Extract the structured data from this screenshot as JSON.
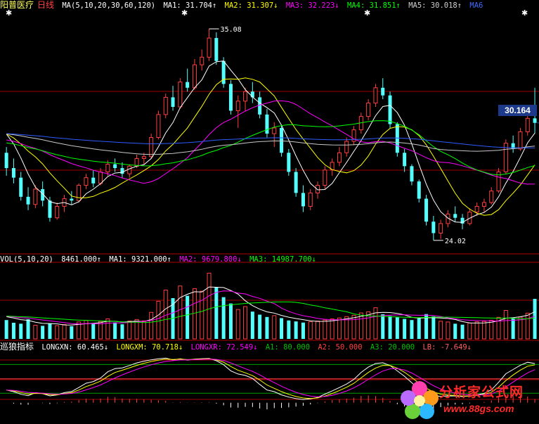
{
  "colors": {
    "up": "#ff4040",
    "down": "#54ffff",
    "ma1": "#ffffff",
    "ma2": "#ffff00",
    "ma3": "#ff00ff",
    "ma4": "#00ff00",
    "ma5": "#c8c8c8",
    "ma6": "#2e5bff",
    "grid": "#a00000",
    "axis": "#b00000"
  },
  "header_price": {
    "stock": "阳普医疗",
    "period": "日线",
    "ma_params": "MA(5,10,20,30,60,120)",
    "ma1": "MA1: 31.704↑",
    "ma2": "MA2: 31.307↓",
    "ma3": "MA3: 32.223↓",
    "ma4": "MA4: 31.851↑",
    "ma5": "MA5: 30.018↑",
    "ma6": "MA6"
  },
  "header_vol": {
    "params": "VOL(5,10,20)",
    "vol": "8461.000↑",
    "ma1": "MA1: 9321.000↑",
    "ma2": "MA2: 9679.800↓",
    "ma3": "MA3: 14987.700↓"
  },
  "header_ind": {
    "name": "巡狼指标",
    "longxn": "LONGXN: 60.465↓",
    "longxm": "LONGXM: 70.718↓",
    "longxr": "LONGXR: 72.549↓",
    "a1": "A1: 80.000",
    "a2": "A2: 50.000",
    "a3": "A3: 20.000",
    "lb": "LB: -7.649↓"
  },
  "markers": {
    "high_label": "35.08",
    "low_label": "24.02",
    "last_price": "30.164"
  },
  "watermark": {
    "title": "分析家公式网",
    "url": "www.88gs.com"
  },
  "chart_data": [
    {
      "type": "candlestick",
      "title": "阳普医疗 日线",
      "ylim": [
        23.5,
        36.0
      ],
      "candles": [
        [
          28.6,
          28.9,
          27.4,
          27.8
        ],
        [
          27.8,
          28.3,
          27.0,
          27.3
        ],
        [
          27.3,
          27.6,
          26.1,
          26.3
        ],
        [
          26.3,
          26.8,
          25.6,
          25.9
        ],
        [
          25.9,
          26.9,
          25.7,
          26.7
        ],
        [
          26.7,
          27.1,
          25.8,
          26.1
        ],
        [
          26.1,
          26.3,
          25.0,
          25.2
        ],
        [
          25.2,
          26.0,
          25.1,
          25.8
        ],
        [
          25.8,
          26.4,
          25.5,
          26.2
        ],
        [
          26.2,
          26.6,
          25.9,
          26.1
        ],
        [
          26.1,
          27.0,
          26.0,
          26.9
        ],
        [
          26.9,
          27.5,
          26.7,
          27.3
        ],
        [
          27.3,
          27.7,
          26.8,
          27.0
        ],
        [
          27.0,
          27.8,
          26.9,
          27.6
        ],
        [
          27.6,
          28.2,
          27.4,
          28.0
        ],
        [
          28.0,
          28.3,
          27.6,
          27.8
        ],
        [
          27.8,
          28.1,
          27.3,
          27.5
        ],
        [
          27.5,
          28.0,
          27.3,
          27.9
        ],
        [
          27.9,
          28.5,
          27.8,
          28.3
        ],
        [
          28.3,
          28.6,
          28.0,
          28.4
        ],
        [
          28.4,
          29.6,
          28.3,
          29.4
        ],
        [
          29.4,
          30.8,
          29.3,
          30.6
        ],
        [
          30.6,
          31.7,
          30.4,
          31.5
        ],
        [
          31.5,
          32.1,
          30.8,
          31.0
        ],
        [
          31.0,
          32.5,
          30.9,
          32.3
        ],
        [
          32.3,
          33.0,
          31.8,
          32.0
        ],
        [
          32.0,
          33.5,
          31.9,
          33.2
        ],
        [
          33.2,
          34.0,
          32.9,
          33.6
        ],
        [
          33.6,
          35.08,
          33.4,
          34.6
        ],
        [
          34.6,
          34.9,
          33.2,
          33.4
        ],
        [
          33.4,
          33.6,
          32.0,
          32.2
        ],
        [
          32.2,
          32.4,
          30.6,
          30.8
        ],
        [
          30.8,
          31.6,
          29.9,
          31.3
        ],
        [
          31.3,
          32.0,
          30.8,
          31.8
        ],
        [
          31.8,
          32.3,
          31.2,
          31.5
        ],
        [
          31.5,
          31.8,
          30.4,
          30.6
        ],
        [
          30.6,
          30.9,
          29.4,
          29.6
        ],
        [
          29.6,
          30.2,
          28.9,
          29.9
        ],
        [
          29.9,
          30.0,
          28.4,
          28.6
        ],
        [
          28.6,
          28.8,
          27.4,
          27.6
        ],
        [
          27.6,
          27.8,
          26.3,
          26.5
        ],
        [
          26.5,
          26.9,
          25.5,
          25.8
        ],
        [
          25.8,
          26.7,
          25.6,
          26.5
        ],
        [
          26.5,
          27.1,
          26.2,
          26.9
        ],
        [
          26.9,
          27.9,
          26.7,
          27.7
        ],
        [
          27.7,
          28.3,
          27.4,
          28.1
        ],
        [
          28.1,
          28.9,
          27.9,
          28.6
        ],
        [
          28.6,
          29.4,
          28.4,
          29.2
        ],
        [
          29.2,
          30.0,
          29.0,
          29.8
        ],
        [
          29.8,
          30.7,
          29.6,
          30.5
        ],
        [
          30.5,
          31.4,
          30.3,
          31.2
        ],
        [
          31.2,
          32.2,
          31.0,
          32.0
        ],
        [
          32.0,
          32.5,
          31.4,
          31.6
        ],
        [
          31.6,
          31.8,
          29.9,
          30.1
        ],
        [
          30.1,
          30.2,
          28.4,
          28.6
        ],
        [
          28.6,
          28.8,
          27.6,
          27.9
        ],
        [
          27.9,
          28.0,
          26.9,
          27.1
        ],
        [
          27.1,
          27.2,
          26.0,
          26.2
        ],
        [
          26.2,
          26.4,
          24.8,
          25.0
        ],
        [
          25.0,
          25.3,
          24.02,
          24.4
        ],
        [
          24.4,
          25.1,
          24.1,
          24.9
        ],
        [
          24.9,
          25.6,
          24.7,
          25.4
        ],
        [
          25.4,
          25.8,
          25.0,
          25.2
        ],
        [
          25.2,
          25.4,
          24.6,
          24.9
        ],
        [
          24.9,
          25.7,
          24.8,
          25.5
        ],
        [
          25.5,
          26.0,
          25.3,
          25.8
        ],
        [
          25.8,
          26.2,
          25.5,
          26.0
        ],
        [
          26.0,
          26.8,
          25.9,
          26.6
        ],
        [
          26.6,
          27.8,
          26.5,
          27.6
        ],
        [
          27.6,
          29.3,
          27.5,
          29.1
        ],
        [
          29.1,
          29.5,
          28.6,
          28.8
        ],
        [
          28.8,
          29.9,
          28.7,
          29.7
        ],
        [
          29.7,
          30.6,
          29.5,
          30.4
        ],
        [
          30.4,
          32.0,
          29.6,
          30.164
        ]
      ]
    },
    {
      "type": "bar",
      "title": "VOL(5,10,20)",
      "values": [
        9800,
        8400,
        7900,
        10200,
        7100,
        6800,
        8100,
        6900,
        7500,
        6600,
        8800,
        9600,
        8200,
        9100,
        10400,
        8600,
        7600,
        9300,
        10100,
        9400,
        13800,
        19600,
        25400,
        21200,
        27500,
        22400,
        26100,
        24800,
        34200,
        26800,
        21700,
        18400,
        15300,
        16800,
        14200,
        12600,
        11400,
        12100,
        10800,
        9600,
        9100,
        8500,
        8900,
        9300,
        9800,
        10400,
        10900,
        11600,
        12300,
        13500,
        14100,
        16200,
        12800,
        11900,
        11200,
        10400,
        9800,
        10600,
        12900,
        11700,
        9200,
        8800,
        7900,
        7400,
        8300,
        8900,
        9100,
        9700,
        11200,
        14800,
        10600,
        11300,
        13400,
        20800
      ],
      "ylim": [
        0,
        38000
      ]
    },
    {
      "type": "line",
      "title": "巡狼指标",
      "ylim": [
        -40,
        110
      ],
      "reference_lines": [
        80,
        50,
        20
      ]
    }
  ]
}
